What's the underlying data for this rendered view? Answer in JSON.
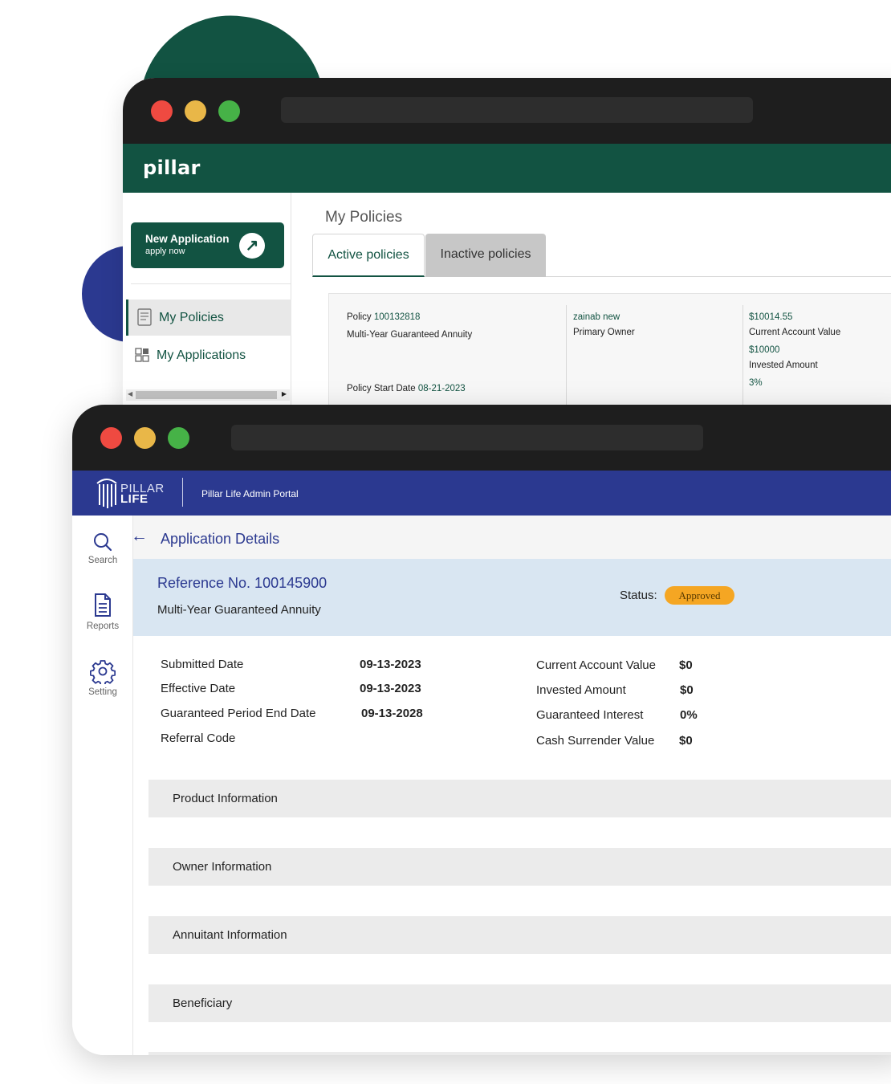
{
  "back_window": {
    "brand": "pillar",
    "new_application": {
      "title": "New Application",
      "subtitle": "apply now",
      "icon": "arrow-up-right-icon"
    },
    "nav": [
      {
        "label": "My Policies",
        "icon": "document-icon",
        "active": true
      },
      {
        "label": "My Applications",
        "icon": "grid-icon",
        "active": false
      }
    ],
    "page_title": "My Policies",
    "tabs": [
      {
        "label": "Active policies",
        "active": true
      },
      {
        "label": "Inactive policies",
        "active": false
      }
    ],
    "policy_card": {
      "policy_label": "Policy",
      "policy_number": "100132818",
      "product": "Multi-Year Guaranteed Annuity",
      "start_label": "Policy Start Date",
      "start_date": "08-21-2023",
      "owner_name": "zainab new",
      "owner_role": "Primary Owner",
      "current_value": "$10014.55",
      "current_value_label": "Current Account Value",
      "invested": "$10000",
      "invested_label": "Invested Amount",
      "rate": "3%"
    }
  },
  "front_window": {
    "logo_word1": "PILLAR",
    "logo_word2": "LIFE",
    "portal_title": "Pillar Life Admin Portal",
    "sidebar": [
      {
        "label": "Search",
        "icon": "search-icon"
      },
      {
        "label": "Reports",
        "icon": "document-icon"
      },
      {
        "label": "Setting",
        "icon": "gear-icon"
      }
    ],
    "page_title": "Application Details",
    "reference": "Reference No. 100145900",
    "product": "Multi-Year Guaranteed Annuity",
    "status_label": "Status:",
    "status_value": "Approved",
    "left_fields": [
      {
        "label": "Submitted Date",
        "value": "09-13-2023"
      },
      {
        "label": "Effective Date",
        "value": "09-13-2023"
      },
      {
        "label": "Guaranteed Period End Date",
        "value": "09-13-2028"
      },
      {
        "label": "Referral Code",
        "value": ""
      }
    ],
    "right_fields": [
      {
        "label": "Current Account Value",
        "value": "$0"
      },
      {
        "label": "Invested Amount",
        "value": "$0"
      },
      {
        "label": "Guaranteed Interest",
        "value": "0%"
      },
      {
        "label": "Cash Surrender Value",
        "value": "$0"
      }
    ],
    "sections": [
      "Product Information",
      "Owner Information",
      "Annuitant Information",
      "Beneficiary"
    ]
  },
  "colors": {
    "brand_green": "#125342",
    "brand_navy": "#2b3990",
    "status_amber": "#f5a623",
    "titlebar": "#1e1e1e"
  }
}
